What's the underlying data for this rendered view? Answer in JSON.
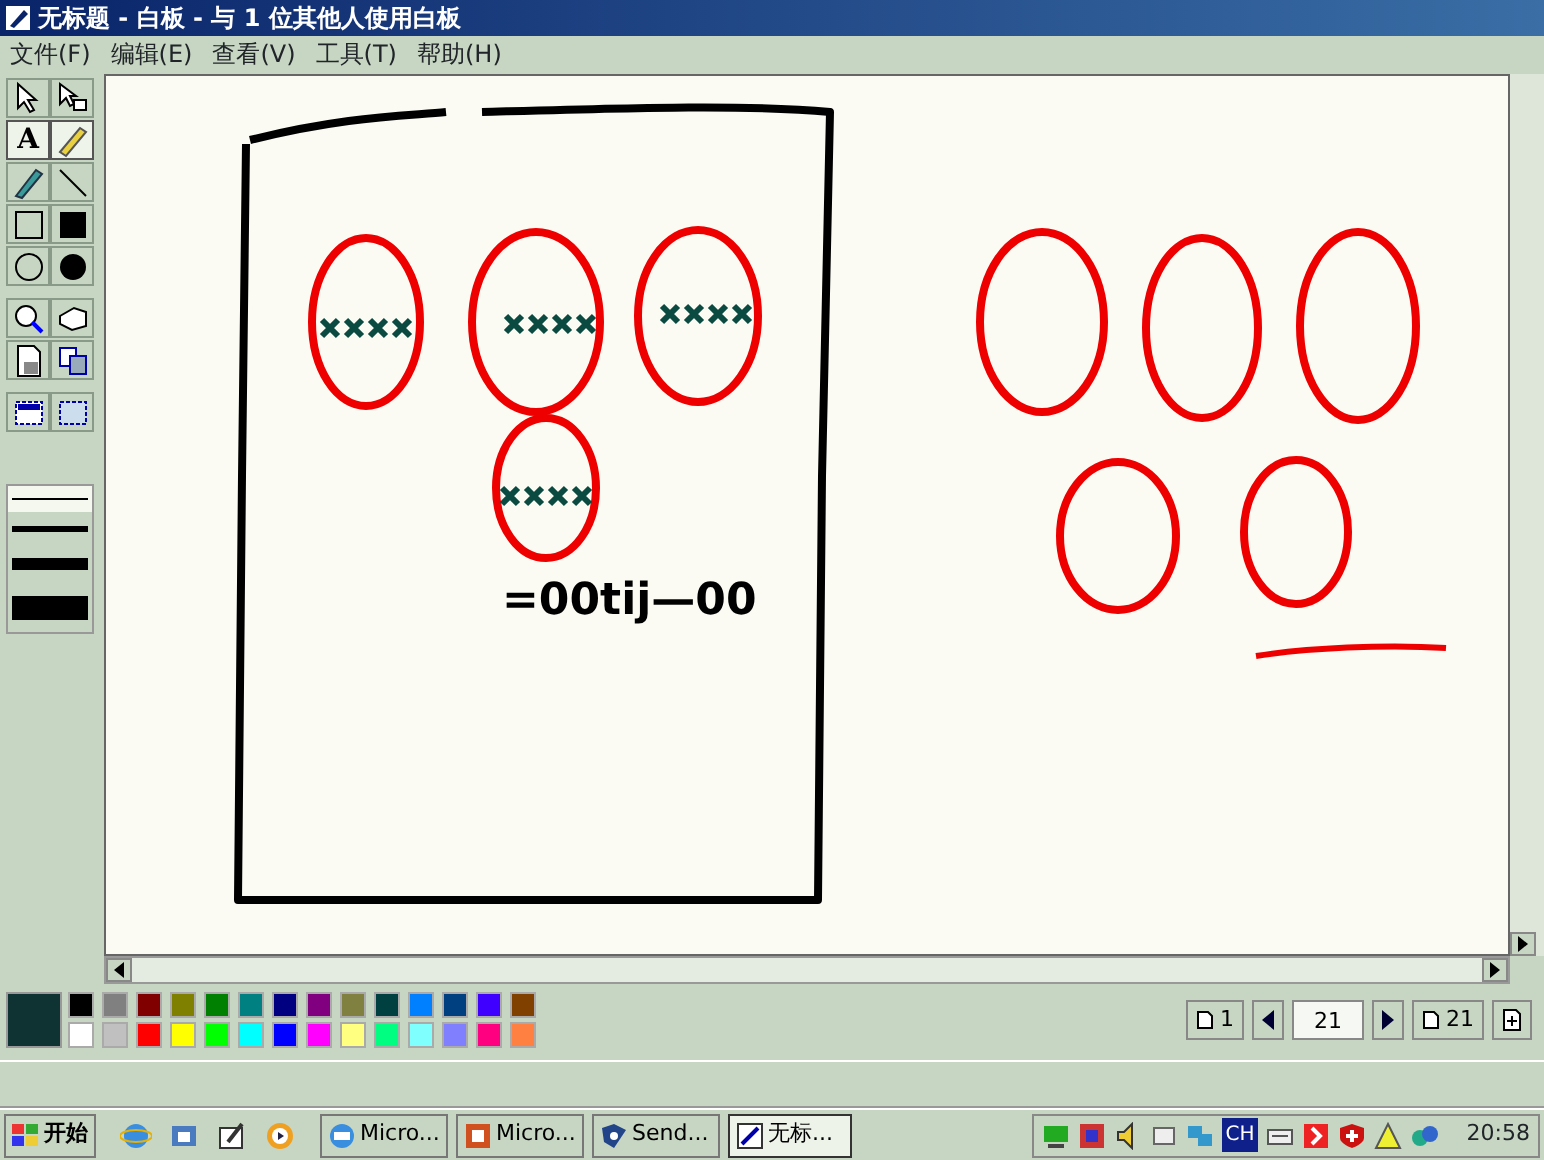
{
  "window": {
    "title": "无标题 - 白板 - 与 1 位其他人使用白板"
  },
  "menu": [
    "文件(F)",
    "编辑(E)",
    "查看(V)",
    "工具(T)",
    "帮助(H)"
  ],
  "tools": [
    {
      "kind": "select",
      "selected": false
    },
    {
      "kind": "select-area",
      "selected": false
    },
    {
      "kind": "text",
      "label": "A",
      "selected": true
    },
    {
      "kind": "highlighter",
      "selected": true
    },
    {
      "kind": "pen",
      "selected": false
    },
    {
      "kind": "line",
      "selected": false
    },
    {
      "kind": "rect",
      "selected": false
    },
    {
      "kind": "rect-filled",
      "selected": false
    },
    {
      "kind": "ellipse",
      "selected": false
    },
    {
      "kind": "ellipse-filled",
      "selected": false
    },
    {
      "kind": "zoom",
      "selected": false
    },
    {
      "kind": "remote-pointer",
      "selected": false
    },
    {
      "kind": "lock",
      "selected": false
    },
    {
      "kind": "sync",
      "selected": false
    },
    {
      "kind": "select-window",
      "selected": false
    },
    {
      "kind": "select-region",
      "selected": false
    }
  ],
  "line_widths": [
    {
      "selected": true
    },
    {
      "selected": false
    },
    {
      "selected": false
    },
    {
      "selected": false
    }
  ],
  "canvas": {
    "handwriting": "=00tij—00"
  },
  "palette": {
    "current": {
      "color": "#0f3232"
    },
    "colors": [
      {
        "color": "#000000"
      },
      {
        "color": "#808080"
      },
      {
        "color": "#800000"
      },
      {
        "color": "#808000"
      },
      {
        "color": "#008000"
      },
      {
        "color": "#008080"
      },
      {
        "color": "#000080"
      },
      {
        "color": "#800080"
      },
      {
        "color": "#808040"
      },
      {
        "color": "#004040"
      },
      {
        "color": "#0080ff"
      },
      {
        "color": "#004080"
      },
      {
        "color": "#4000ff"
      },
      {
        "color": "#804000"
      },
      {
        "color": "#ffffff"
      },
      {
        "color": "#c0c0c0"
      },
      {
        "color": "#ff0000"
      },
      {
        "color": "#ffff00"
      },
      {
        "color": "#00ff00"
      },
      {
        "color": "#00ffff"
      },
      {
        "color": "#0000ff"
      },
      {
        "color": "#ff00ff"
      },
      {
        "color": "#ffff80"
      },
      {
        "color": "#00ff80"
      },
      {
        "color": "#80ffff"
      },
      {
        "color": "#8080ff"
      },
      {
        "color": "#ff0080"
      },
      {
        "color": "#ff8040"
      }
    ]
  },
  "page_nav": {
    "first": "1",
    "current": "21",
    "last": "21"
  },
  "taskbar": {
    "start": "开始",
    "tasks": [
      {
        "label": "Micro...",
        "kind": "ie",
        "selected": false
      },
      {
        "label": "Micro...",
        "kind": "ppt",
        "selected": false
      },
      {
        "label": "Send...",
        "kind": "send",
        "selected": false
      },
      {
        "label": "无标...",
        "kind": "whiteboard",
        "selected": true
      }
    ],
    "tray_text": "CH",
    "clock": "20:58"
  }
}
